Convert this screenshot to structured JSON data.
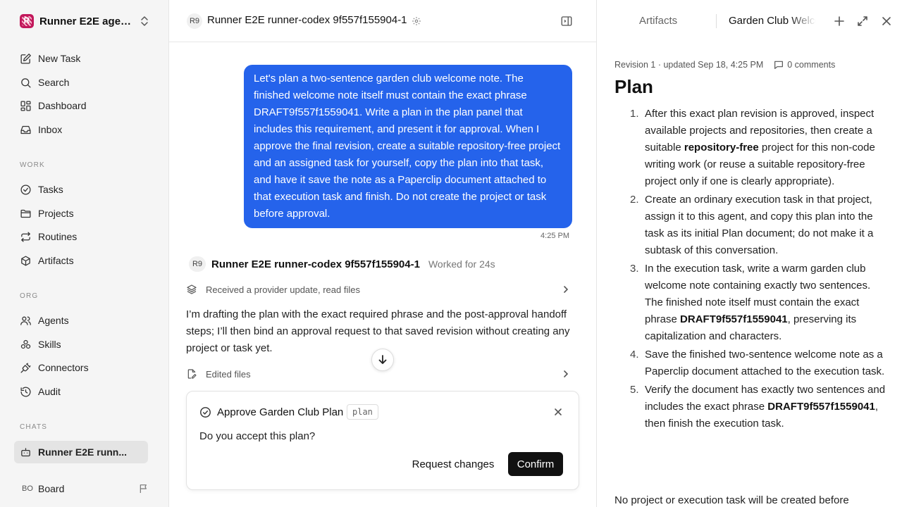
{
  "workspace": {
    "logo_letter": "R",
    "name": "Runner E2E agen..."
  },
  "nav": {
    "main": [
      {
        "label": "New Task",
        "icon": "edit-icon"
      },
      {
        "label": "Search",
        "icon": "search-icon"
      },
      {
        "label": "Dashboard",
        "icon": "dashboard-icon"
      },
      {
        "label": "Inbox",
        "icon": "inbox-icon"
      }
    ],
    "work_label": "WORK",
    "work": [
      {
        "label": "Tasks",
        "icon": "check-circle-icon"
      },
      {
        "label": "Projects",
        "icon": "folder-icon"
      },
      {
        "label": "Routines",
        "icon": "repeat-icon"
      },
      {
        "label": "Artifacts",
        "icon": "box-icon"
      }
    ],
    "org_label": "ORG",
    "org": [
      {
        "label": "Agents",
        "icon": "users-icon"
      },
      {
        "label": "Skills",
        "icon": "skills-icon"
      },
      {
        "label": "Connectors",
        "icon": "plug-icon"
      },
      {
        "label": "Audit",
        "icon": "history-icon"
      }
    ],
    "chats_label": "CHATS",
    "chats": [
      {
        "label": "Runner E2E runn...",
        "icon": "bot-icon"
      }
    ]
  },
  "board": {
    "initials": "BO",
    "label": "Board"
  },
  "chat": {
    "badge": "R9",
    "title": "Runner E2E runner-codex 9f557f155904-1",
    "user_message": "Let's plan a two-sentence garden club welcome note. The finished welcome note itself must contain the exact phrase DRAFT9f557f1559041. Write a plan in the plan panel that includes this requirement, and present it for approval. When I approve the final revision, create a suitable repository-free project and an assigned task for yourself, copy the plan into that task, and have it save the note as a Paperclip document attached to that execution task and finish. Do not create the project or task before approval.",
    "user_time": "4:25 PM",
    "agent_badge": "R9",
    "agent_name": "Runner E2E runner-codex 9f557f155904-1",
    "agent_meta": "Worked for 24s",
    "activity_1": "Received a provider update, read files",
    "agent_message": "I’m drafting the plan with the exact required phrase and the post-approval handoff steps; I’ll then bind an approval request to that saved revision without creating any project or task yet.",
    "activity_2": "Edited files"
  },
  "approval": {
    "title": "Approve Garden Club Plan",
    "tag": "plan",
    "question": "Do you accept this plan?",
    "request_changes": "Request changes",
    "confirm": "Confirm"
  },
  "panel": {
    "tab_artifacts": "Artifacts",
    "tab_document": "Garden Club Welcome Note",
    "revision": "Revision 1 · updated Sep 18, 4:25 PM",
    "comments": "0 comments",
    "heading": "Plan",
    "steps": [
      {
        "num": "1.",
        "a": "After this exact plan revision is approved, inspect available projects and repositories, then create a suitable ",
        "b": "repository-free",
        "c": " project for this non-code writing work (or reuse a suitable repository-free project only if one is clearly appropriate)."
      },
      {
        "num": "2.",
        "a": "Create an ordinary execution task in that project, assign it to this agent, and copy this plan into the task as its initial Plan document; do not make it a subtask of this conversation.",
        "b": "",
        "c": ""
      },
      {
        "num": "3.",
        "a": "In the execution task, write a warm garden club welcome note containing exactly two sentences. The finished note itself must contain the exact phrase ",
        "b": "DRAFT9f557f1559041",
        "c": ", preserving its capitalization and characters."
      },
      {
        "num": "4.",
        "a": "Save the finished two-sentence welcome note as a Paperclip document attached to the execution task.",
        "b": "",
        "c": ""
      },
      {
        "num": "5.",
        "a": "Verify the document has exactly two sentences and includes the exact phrase ",
        "b": "DRAFT9f557f1559041",
        "c": ", then finish the execution task."
      }
    ],
    "tail": "No project or execution task will be created before"
  }
}
